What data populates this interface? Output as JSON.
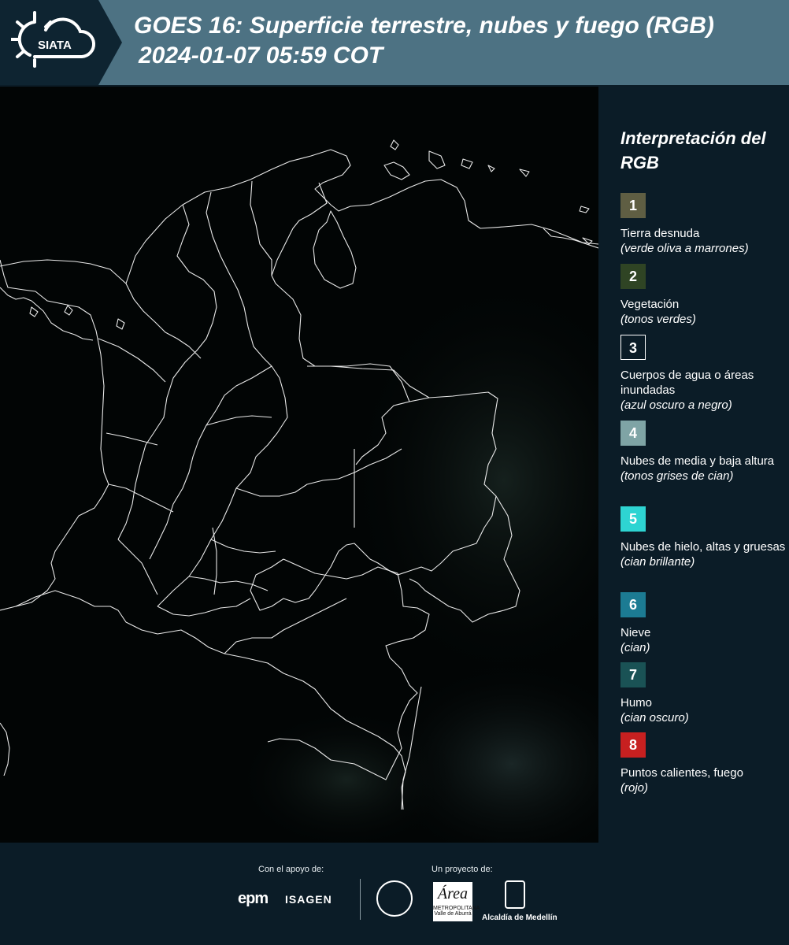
{
  "header": {
    "logo_text": "SIATA",
    "title_line1": "GOES 16: Superficie terrestre, nubes y fuego (RGB)",
    "title_line2": "2024-01-07 05:59 COT"
  },
  "legend": {
    "title": "Interpretación del RGB",
    "items": [
      {
        "num": "1",
        "name": "Tierra desnuda",
        "desc": "(verde oliva a marrones)",
        "color": "#5f5e43"
      },
      {
        "num": "2",
        "name": "Vegetación",
        "desc": "(tonos verdes)",
        "color": "#2f4424"
      },
      {
        "num": "3",
        "name": "Cuerpos de agua o áreas inundadas",
        "desc": "(azul oscuro a negro)",
        "color": "#0b1c27"
      },
      {
        "num": "4",
        "name": "Nubes de media y baja altura",
        "desc": "(tonos grises de cian)",
        "color": "#7fa4a5"
      },
      {
        "num": "5",
        "name": "Nubes de hielo, altas y gruesas",
        "desc": "(cian brillante)",
        "color": "#2ed4d2"
      },
      {
        "num": "6",
        "name": "Nieve",
        "desc": "(cian)",
        "color": "#1c7b93"
      },
      {
        "num": "7",
        "name": "Humo",
        "desc": "(cian oscuro)",
        "color": "#1a5255"
      },
      {
        "num": "8",
        "name": "Puntos calientes, fuego",
        "desc": "(rojo)",
        "color": "#c72020"
      }
    ]
  },
  "footer": {
    "support_label": "Con el apoyo de:",
    "project_label": "Un proyecto de:",
    "epm": "epm",
    "isagen": "ISAGEN",
    "area_logo": "Área",
    "area_sub": "METROPOLITANA Valle de Aburrá",
    "alcaldia": "Alcaldía de Medellín"
  },
  "colors": {
    "header_bg": "#4d7283",
    "panel_bg": "#0b1c27",
    "map_bg": "#020505",
    "border_line": "#e9e9e9"
  }
}
